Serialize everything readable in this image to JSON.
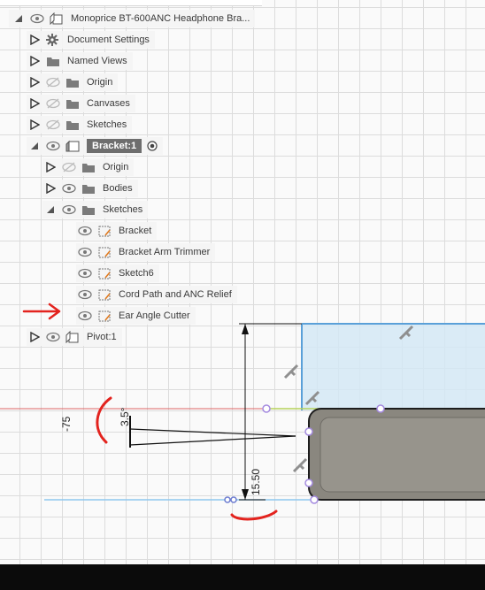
{
  "browser": {
    "root_label": "Monoprice BT-600ANC Headphone Bra...",
    "items": [
      {
        "label": "Document Settings",
        "icon": "gear-icon"
      },
      {
        "label": "Named Views",
        "icon": "folder-icon"
      },
      {
        "label": "Origin",
        "icon": "folder-icon"
      },
      {
        "label": "Canvases",
        "icon": "folder-icon"
      },
      {
        "label": "Sketches",
        "icon": "folder-icon"
      }
    ],
    "component": {
      "label": "Bracket:1",
      "icon": "component-icon"
    },
    "children": [
      {
        "label": "Origin",
        "icon": "folder-icon"
      },
      {
        "label": "Bodies",
        "icon": "folder-icon"
      },
      {
        "label": "Sketches",
        "icon": "folder-icon"
      }
    ],
    "sketches": [
      {
        "label": "Bracket",
        "icon": "sketch-icon"
      },
      {
        "label": "Bracket Arm Trimmer",
        "icon": "sketch-icon"
      },
      {
        "label": "Sketch6",
        "icon": "sketch-icon"
      },
      {
        "label": "Cord Path and ANC Relief",
        "icon": "sketch-icon"
      },
      {
        "label": "Ear Angle Cutter",
        "icon": "sketch-icon"
      }
    ],
    "pivot": {
      "label": "Pivot:1",
      "icon": "component-icon"
    }
  },
  "dimensions": {
    "left": "-75",
    "angle": "3.5°",
    "height": "15.50"
  },
  "colors": {
    "annotation": "#e3231e",
    "sketch_line": "#a58be0",
    "selection": "#6e6e6e",
    "body_fill": "#8a877f"
  }
}
